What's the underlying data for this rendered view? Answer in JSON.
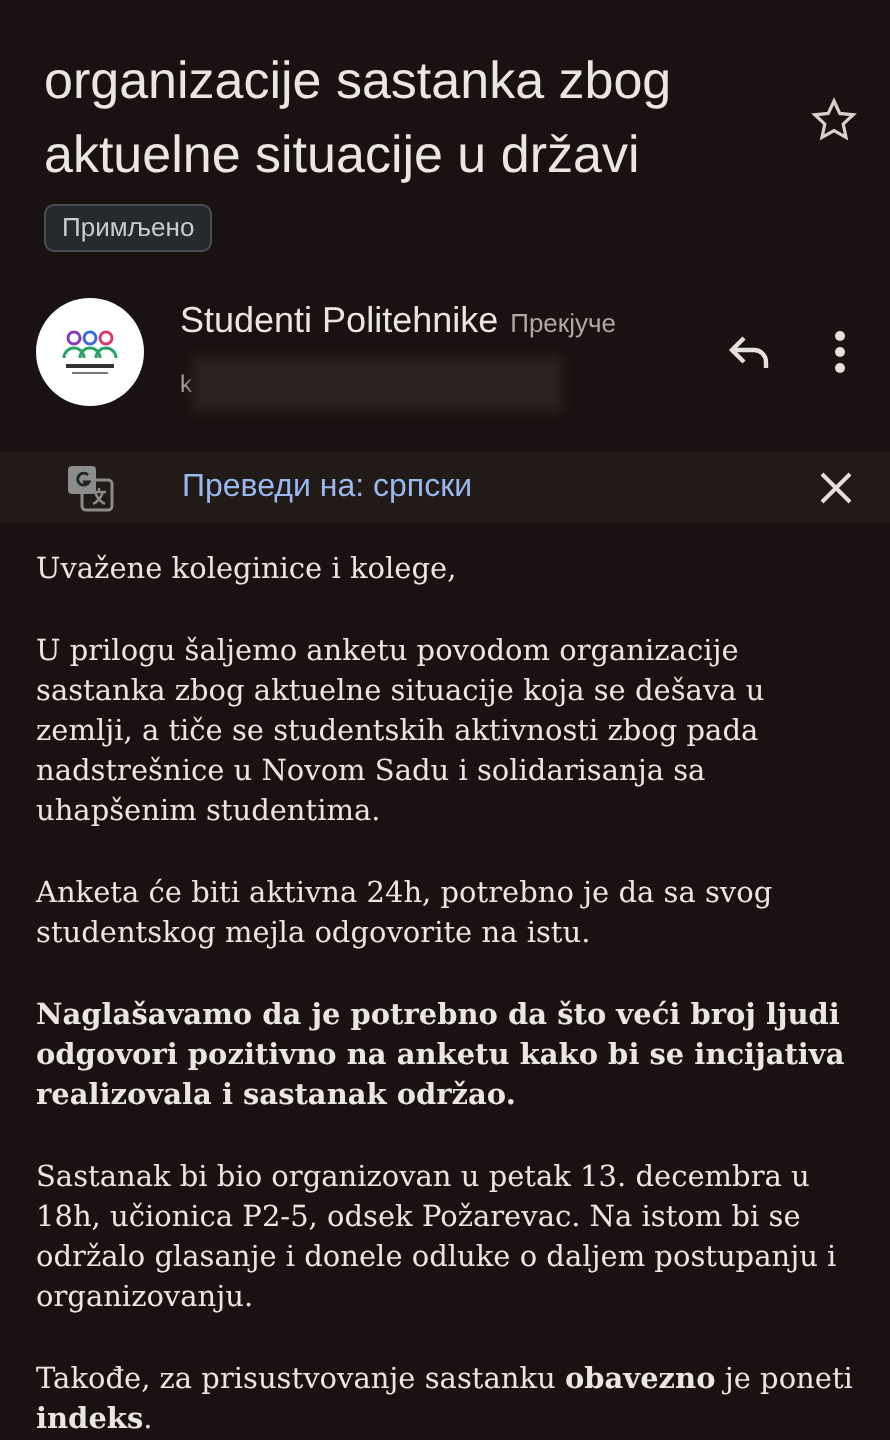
{
  "subject": {
    "lines": [
      "organizacije sastanka zbog",
      "aktuelne situacije u državi"
    ],
    "starred": false,
    "label": "Примљено"
  },
  "sender": {
    "name": "Studenti Politehnike",
    "time": "Прекјуче",
    "recipient_start": "k"
  },
  "translate_bar": {
    "text": "Преведи на: српски"
  },
  "body": [
    "Uvažene koleginice i kolege,",
    "U prilogu šaljemo anketu povodom organizacije sastanka zbog aktuelne situacije koja se dešava u zemlji, a tiče se studentskih aktivnosti zbog pada nadstrešnice u Novom Sadu i solidarisanja sa uhapšenim studentima.",
    "Anketa će biti aktivna 24h, potrebno je da sa svog studentskog mejla odgovorite na istu.",
    "**Naglašavamo da je potrebno da što veći broj ljudi odgovori pozitivno na anketu kako bi se incijativa realizovala i sastanak održao.**",
    "Sastanak bi bio organizovan u petak 13. decembra u 18h, učionica P2-5, odsek Požarevac. Na istom bi se održalo glasanje i donele odluke o daljem postupanju i organizovanju.",
    "Takođe, za prisustvovanje sastanku **obavezno** je poneti **indeks**."
  ]
}
